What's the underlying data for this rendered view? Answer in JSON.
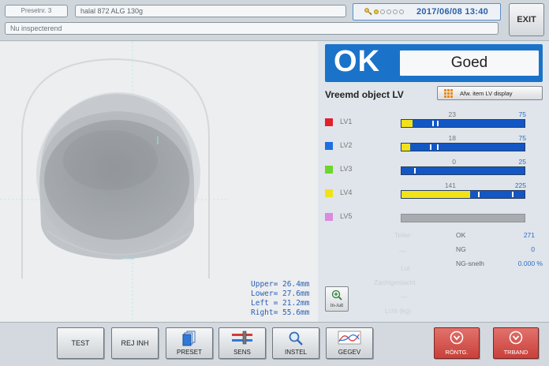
{
  "header": {
    "preset": "Presetnr. 3",
    "product": "halal 872 ALG 130g",
    "status": "Nu inspecterend",
    "datetime": "2017/06/08  13:40",
    "icons": [
      "key-icon",
      "signal-dots"
    ],
    "exit_label": "EXIT"
  },
  "result": {
    "ok_label": "OK",
    "result_text": "Goed",
    "ok_color": "#1b73c9"
  },
  "lv_section": {
    "title": "Vreemd object LV",
    "display_button_label": "Afw. item LV display",
    "rows": [
      {
        "name": "LV1",
        "value": "23",
        "limit": "75",
        "color": "#e2202d",
        "fill_fraction": 0.09,
        "marks": [
          0.25,
          0.29
        ],
        "enabled": true
      },
      {
        "name": "LV2",
        "value": "18",
        "limit": "75",
        "color": "#1e6fe0",
        "fill_fraction": 0.07,
        "marks": [
          0.23,
          0.29
        ],
        "enabled": true
      },
      {
        "name": "LV3",
        "value": "0",
        "limit": "25",
        "color": "#6ed62a",
        "fill_fraction": 0.0,
        "marks": [
          0.1
        ],
        "enabled": true
      },
      {
        "name": "LV4",
        "value": "141",
        "limit": "225",
        "color": "#f2e21a",
        "fill_fraction": 0.56,
        "marks": [
          0.62,
          0.9
        ],
        "enabled": true
      },
      {
        "name": "LV5",
        "value": "",
        "limit": "",
        "color": "#d98be0",
        "fill_fraction": 0.0,
        "marks": [],
        "enabled": false
      }
    ]
  },
  "stats": {
    "faint_labels": [
      "Teller",
      "—",
      "Lot",
      "Zachtgeslacht",
      "—",
      "Lcht (kg)"
    ],
    "items": [
      {
        "label": "OK",
        "value": "271"
      },
      {
        "label": "NG",
        "value": "0"
      },
      {
        "label": "NG-snelh",
        "value": "0.000  %"
      }
    ]
  },
  "zoom": {
    "label": "In-/uit"
  },
  "dimensions": {
    "upper": "Upper= 26.4mm",
    "lower": "Lower= 27.6mm",
    "left": "Left = 21.2mm",
    "right": "Right= 55.6mm"
  },
  "toolbar": {
    "test": "TEST",
    "rej_inh": "REJ INH",
    "preset": "PRESET",
    "sens": "SENS",
    "instel": "INSTEL",
    "gegev": "GEGEV",
    "rontg": "RÖNTG.",
    "trband": "TRBAND"
  }
}
